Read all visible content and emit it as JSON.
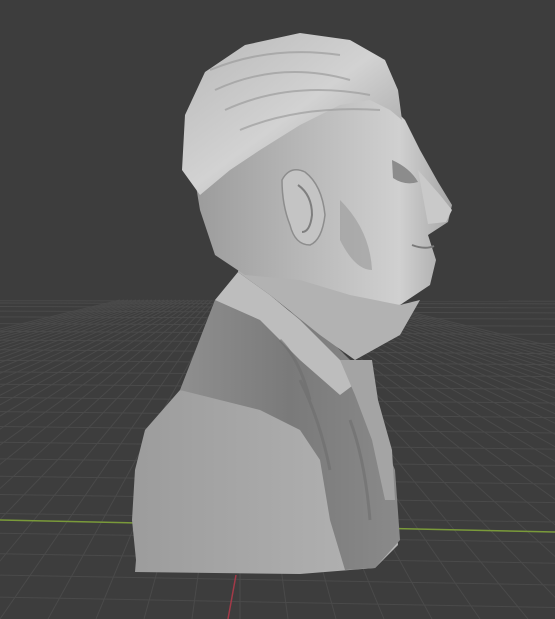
{
  "viewport": {
    "background_color": "#3d3d3d",
    "grid_line_color": "#4a4a4a",
    "x_axis_color": "#8a3a44",
    "y_axis_color": "#5f8a2a",
    "model_base_color": "#a8a8a8",
    "model_highlight_color": "#cfcfcf",
    "model_shadow_color": "#6f6f6f"
  }
}
